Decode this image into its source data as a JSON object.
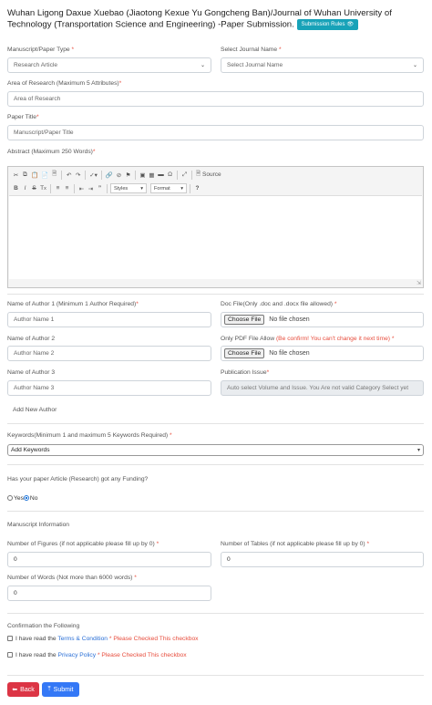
{
  "page": {
    "title": "Wuhan Ligong Daxue Xuebao (Jiaotong Kexue Yu Gongcheng Ban)/Journal of Wuhan University of Technology (Transportation Science and Engineering) -Paper Submission.",
    "rules_button": "Submission Rules"
  },
  "form": {
    "type_label": "Manuscript/Paper Type",
    "type_value": "Research Article",
    "journal_label": "Select Journal Name",
    "journal_value": "Select Journal Name",
    "area_label": "Area of Research (Maximum 5 Attributes)",
    "area_placeholder": "Area of Research",
    "title_label": "Paper Title",
    "title_placeholder": "Manuscript/Paper Title",
    "abstract_label": "Abstract (Maximum 250 Words)",
    "editor": {
      "source_label": "Source",
      "styles_label": "Styles",
      "format_label": "Format"
    },
    "author1_label": "Name of Author 1 (Minimum 1 Author Required)",
    "author1_placeholder": "Author Name 1",
    "author2_label": "Name of Author 2",
    "author2_placeholder": "Author Name 2",
    "author3_label": "Name of Author 3",
    "author3_placeholder": "Author Name 3",
    "add_author": "Add New Author",
    "doc_label": "Doc File(Only .doc and .docx file allowed)",
    "pdf_label": "Only PDF File Allow",
    "pdf_warning": "(Be confirm! You can't change it next time)",
    "choose_file": "Choose File",
    "no_file": "No file chosen",
    "issue_label": "Publication Issue",
    "issue_value": "Auto select Volume and Issue. You Are not valid Category Select yet",
    "keywords_label": "Keywords(Minimum 1 and maximum 5 Keywords Required)",
    "keywords_value": "Add Keywords",
    "funding_label": "Has your paper Article (Research) got any Funding?",
    "funding_yes": "Yes",
    "funding_no": "No",
    "manuscript_info": "Manuscript Information",
    "figures_label": "Number of Figures (if not applicable please fill up by 0)",
    "figures_value": "0",
    "tables_label": "Number of Tables (if not applicable please fill up by 0)",
    "tables_value": "0",
    "words_label": "Number of Words (Not more than 6000 words)",
    "words_value": "0",
    "confirm_label": "Confirmation the Following",
    "terms_prefix": "I have read the",
    "terms_link": "Terms & Condition",
    "terms_warning": "* Please Checked This checkbox",
    "privacy_prefix": "I have read the",
    "privacy_link": "Privacy Policy",
    "privacy_warning": "* Please Checked This checkbox",
    "req_mark": "*"
  },
  "buttons": {
    "back": "Back",
    "submit": "Submit"
  },
  "colors": {
    "back": "#dc3545",
    "submit": "#3478f6",
    "rules": "#17a2b8"
  }
}
